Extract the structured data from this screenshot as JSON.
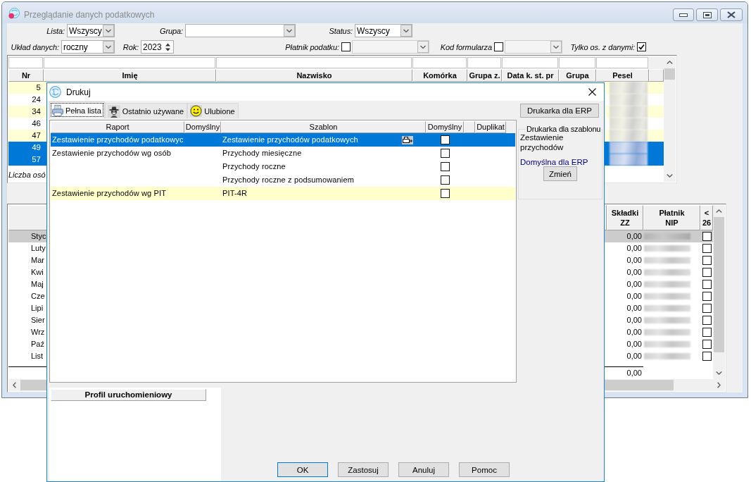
{
  "main_window": {
    "title": "Przeglądanie danych podatkowych",
    "filter_rows": [
      [
        {
          "kind": "combo",
          "label": "Lista:",
          "value": "Wszyscy"
        },
        {
          "kind": "combo",
          "label": "Grupa:"
        },
        {
          "kind": "combo",
          "label": "Status:",
          "value": "Wszyscy"
        }
      ],
      [
        {
          "kind": "combo",
          "label": "Układ danych:",
          "value": "roczny"
        },
        {
          "kind": "spin",
          "label": "Rok:",
          "value": "2023"
        },
        {
          "kind": "check_combo",
          "label": "Płatnik podatku:",
          "checked": false
        },
        {
          "kind": "check_combo",
          "label": "Kod formularza",
          "checked": false
        },
        {
          "kind": "check",
          "label": "Tylko os. z danymi:",
          "checked": true
        }
      ]
    ],
    "people_grid": {
      "columns": [
        "Nr",
        "Imię",
        "Nazwisko",
        "Komórka",
        "Grupa z.",
        "Data k. st. pr",
        "Grupa",
        "Pesel"
      ],
      "rows": [
        {
          "nr": "5",
          "selected": false
        },
        {
          "nr": "24",
          "selected": false
        },
        {
          "nr": "34",
          "selected": false
        },
        {
          "nr": "46",
          "selected": false
        },
        {
          "nr": "47",
          "selected": false
        },
        {
          "nr": "49",
          "selected": true
        },
        {
          "nr": "57",
          "selected": true
        }
      ],
      "footer": "Liczba osó"
    },
    "months_grid": {
      "columns": [
        "Składki ZZ",
        "Płatnik NIP",
        "< 26"
      ],
      "rows": [
        {
          "month": "Styc",
          "skladki_zz": "0,00",
          "under_26": false,
          "selected": true
        },
        {
          "month": "Luty",
          "skladki_zz": "0,00",
          "under_26": false,
          "selected": false
        },
        {
          "month": "Mar",
          "skladki_zz": "0,00",
          "under_26": false,
          "selected": false
        },
        {
          "month": "Kwi",
          "skladki_zz": "0,00",
          "under_26": false,
          "selected": false
        },
        {
          "month": "Maj",
          "skladki_zz": "0,00",
          "under_26": false,
          "selected": false
        },
        {
          "month": "Cze",
          "skladki_zz": "0,00",
          "under_26": false,
          "selected": false
        },
        {
          "month": "Lipi",
          "skladki_zz": "0,00",
          "under_26": false,
          "selected": false
        },
        {
          "month": "Sier",
          "skladki_zz": "0,00",
          "under_26": false,
          "selected": false
        },
        {
          "month": "Wrz",
          "skladki_zz": "0,00",
          "under_26": false,
          "selected": false
        },
        {
          "month": "Paź",
          "skladki_zz": "0,00",
          "under_26": false,
          "selected": false
        },
        {
          "month": "List",
          "skladki_zz": "0,00",
          "under_26": false,
          "selected": false
        }
      ],
      "total": "0,00"
    }
  },
  "dialog": {
    "title": "Drukuj",
    "tabs": [
      {
        "label": "Pełna lista",
        "selected": true
      },
      {
        "label": "Ostatnio używane",
        "selected": false
      },
      {
        "label": "Ulubione",
        "selected": false
      }
    ],
    "report_table": {
      "columns": [
        "Raport",
        "Domyślny",
        "Szablon",
        "Domyślny",
        "Duplikat"
      ],
      "rows": [
        {
          "report": "Zestawienie przychodów podatkowyc",
          "template": "Zestawienie przychodów podatkowych",
          "printer_assigned": true,
          "default": false,
          "selected": true,
          "highlighted": false
        },
        {
          "report": "Zestawienie przychodów wg osób",
          "template": "Przychody miesięczne",
          "printer_assigned": false,
          "default": false,
          "selected": false,
          "highlighted": false
        },
        {
          "template": "Przychody roczne",
          "printer_assigned": false,
          "default": false,
          "selected": false,
          "highlighted": false
        },
        {
          "template": "Przychody roczne z podsumowaniem",
          "printer_assigned": false,
          "default": false,
          "selected": false,
          "highlighted": false
        },
        {
          "report": "Zestawienie przychodów wg PIT",
          "template": "PIT-4R",
          "printer_assigned": false,
          "default": false,
          "selected": false,
          "highlighted": true
        }
      ]
    },
    "printer_button": "Drukarka dla ERP",
    "printer_group": {
      "title": "Drukarka dla szablonu",
      "template": "Zestawienie przychodów",
      "printer": "Domyślna dla ERP",
      "change_button": "Zmień"
    },
    "profile_panel": {
      "header": "Profil uruchomieniowy"
    },
    "buttons": [
      {
        "label": "OK",
        "default": true
      },
      {
        "label": "Zastosuj",
        "default": false
      },
      {
        "label": "Anuluj",
        "default": false
      },
      {
        "label": "Pomoc",
        "default": false
      }
    ]
  }
}
